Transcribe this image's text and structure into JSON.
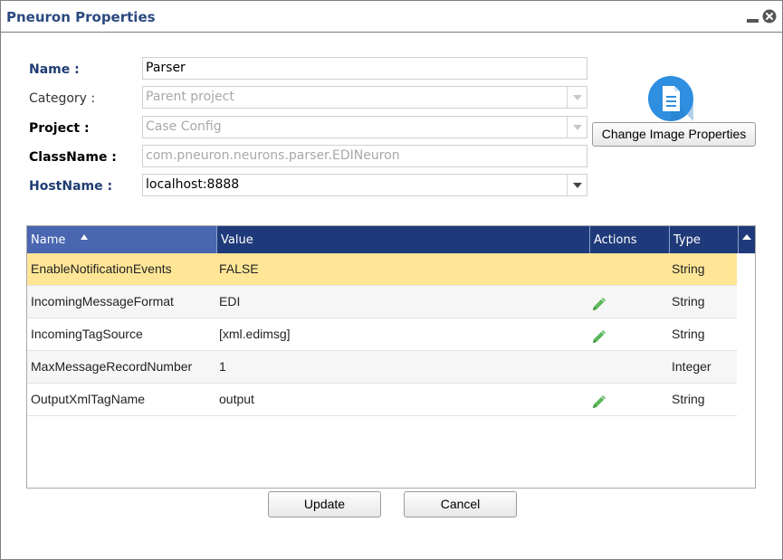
{
  "window": {
    "title": "Pneuron Properties"
  },
  "form": {
    "name_label": "Name :",
    "name_value": "Parser",
    "category_label": "Category :",
    "category_value": "Parent project",
    "project_label": "Project :",
    "project_value": "Case Config",
    "classname_label": "ClassName :",
    "classname_value": "com.pneuron.neurons.parser.EDINeuron",
    "hostname_label": "HostName :",
    "hostname_value": "localhost:8888"
  },
  "image": {
    "icon": "document-icon",
    "accent": "#2e8ee0",
    "change_button": "Change Image Properties"
  },
  "grid": {
    "headers": {
      "name": "Name",
      "value": "Value",
      "actions": "Actions",
      "type": "Type"
    },
    "sort": {
      "column": "Name",
      "direction": "ascending"
    },
    "header_color": "#1f3a7a",
    "selected_color": "#ffe697",
    "rows": [
      {
        "name": "EnableNotificationEvents",
        "value": "FALSE",
        "editable": false,
        "type": "String"
      },
      {
        "name": "IncomingMessageFormat",
        "value": "EDI",
        "editable": true,
        "type": "String"
      },
      {
        "name": "IncomingTagSource",
        "value": "[xml.edimsg]",
        "editable": true,
        "type": "String"
      },
      {
        "name": "MaxMessageRecordNumber",
        "value": "1",
        "editable": false,
        "type": "Integer"
      },
      {
        "name": "OutputXmlTagName",
        "value": "output",
        "editable": true,
        "type": "String"
      }
    ]
  },
  "buttons": {
    "update": "Update",
    "cancel": "Cancel"
  }
}
